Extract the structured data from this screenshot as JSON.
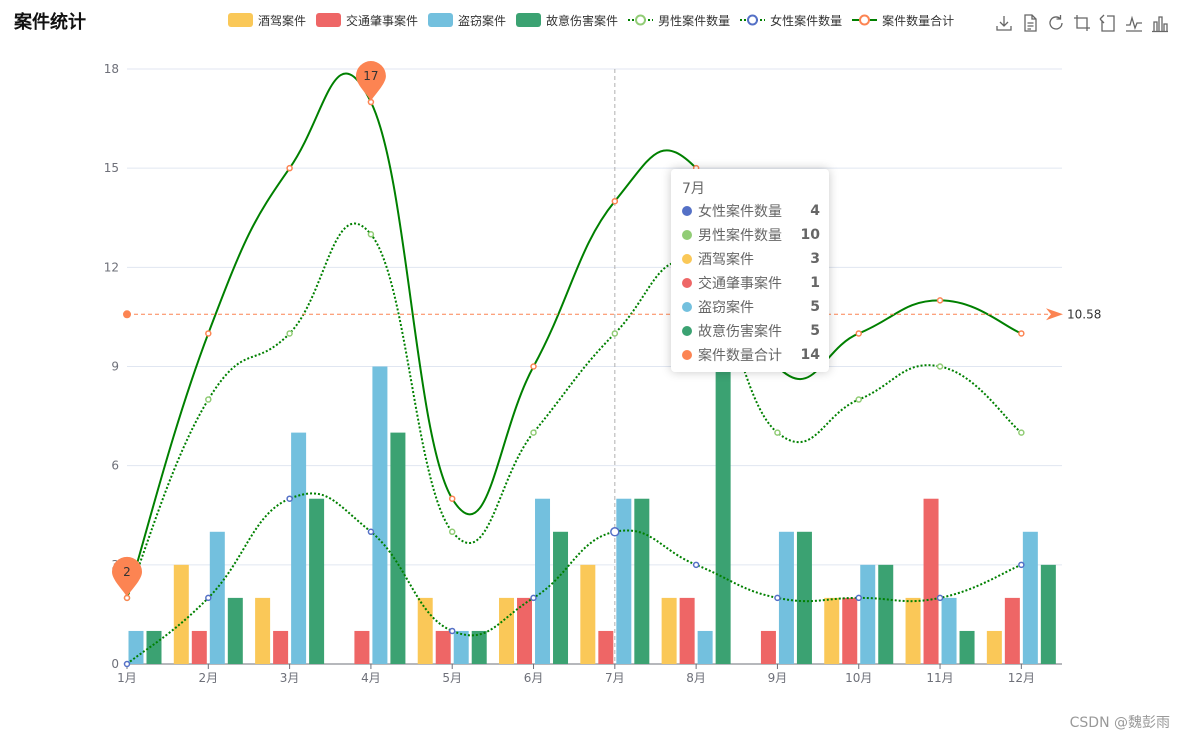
{
  "title": "案件统计",
  "watermark": "CSDN @魏彭雨",
  "legend": [
    {
      "label": "酒驾案件",
      "color": "#fac858",
      "kind": "bar"
    },
    {
      "label": "交通肇事案件",
      "color": "#ee6666",
      "kind": "bar"
    },
    {
      "label": "盗窃案件",
      "color": "#73c0de",
      "kind": "bar"
    },
    {
      "label": "故意伤害案件",
      "color": "#3ba272",
      "kind": "bar"
    },
    {
      "label": "男性案件数量",
      "color": "#91cc75",
      "kind": "dotted"
    },
    {
      "label": "女性案件数量",
      "color": "#5470c6",
      "kind": "dotted"
    },
    {
      "label": "案件数量合计",
      "color": "#fc8452",
      "kind": "solid"
    }
  ],
  "toolbox": [
    "download-icon",
    "data-view-icon",
    "restore-icon",
    "zoom-icon",
    "zoom-reset-icon",
    "line-switch-icon",
    "bar-switch-icon"
  ],
  "chart_data": {
    "type": "bar",
    "categories": [
      "1月",
      "2月",
      "3月",
      "4月",
      "5月",
      "6月",
      "7月",
      "8月",
      "9月",
      "10月",
      "11月",
      "12月"
    ],
    "ylim": [
      0,
      18
    ],
    "yticks": [
      0,
      3,
      6,
      9,
      12,
      15,
      18
    ],
    "grid": true,
    "bar_series": [
      {
        "name": "酒驾案件",
        "color": "#fac858",
        "values": [
          0,
          3,
          2,
          0,
          2,
          2,
          3,
          2,
          0,
          2,
          2,
          1
        ]
      },
      {
        "name": "交通肇事案件",
        "color": "#ee6666",
        "values": [
          0,
          1,
          1,
          1,
          1,
          2,
          1,
          2,
          1,
          2,
          5,
          2
        ]
      },
      {
        "name": "盗窃案件",
        "color": "#73c0de",
        "values": [
          1,
          4,
          7,
          9,
          1,
          5,
          5,
          1,
          4,
          3,
          2,
          4
        ]
      },
      {
        "name": "故意伤害案件",
        "color": "#3ba272",
        "values": [
          1,
          2,
          5,
          7,
          1,
          4,
          5,
          9,
          4,
          3,
          1,
          3
        ]
      }
    ],
    "line_series": [
      {
        "name": "男性案件数量",
        "color": "#91cc75",
        "line_color": "#008000",
        "style": "dotted",
        "values": [
          2,
          8,
          10,
          13,
          4,
          7,
          10,
          12,
          7,
          8,
          9,
          7
        ]
      },
      {
        "name": "女性案件数量",
        "color": "#5470c6",
        "line_color": "#008000",
        "style": "dotted",
        "values": [
          0,
          2,
          5,
          4,
          1,
          2,
          4,
          3,
          2,
          2,
          2,
          3
        ]
      },
      {
        "name": "案件数量合计",
        "color": "#fc8452",
        "line_color": "#008000",
        "style": "solid",
        "values": [
          2,
          10,
          15,
          17,
          5,
          9,
          14,
          15,
          9,
          10,
          11,
          10
        ]
      }
    ],
    "mark_points": [
      {
        "label": "17",
        "category": "4月",
        "value": 17
      },
      {
        "label": "2",
        "category": "1月",
        "value": 2
      }
    ],
    "average_line": {
      "value": 10.58,
      "label": "10.58",
      "color": "#fc8452"
    },
    "axis_pointer_category": "7月",
    "tooltip": {
      "title": "7月",
      "rows": [
        {
          "name": "女性案件数量",
          "value": "4",
          "color": "#5470c6"
        },
        {
          "name": "男性案件数量",
          "value": "10",
          "color": "#91cc75"
        },
        {
          "name": "酒驾案件",
          "value": "3",
          "color": "#fac858"
        },
        {
          "name": "交通肇事案件",
          "value": "1",
          "color": "#ee6666"
        },
        {
          "name": "盗窃案件",
          "value": "5",
          "color": "#73c0de"
        },
        {
          "name": "故意伤害案件",
          "value": "5",
          "color": "#3ba272"
        },
        {
          "name": "案件数量合计",
          "value": "14",
          "color": "#fc8452"
        }
      ]
    }
  }
}
